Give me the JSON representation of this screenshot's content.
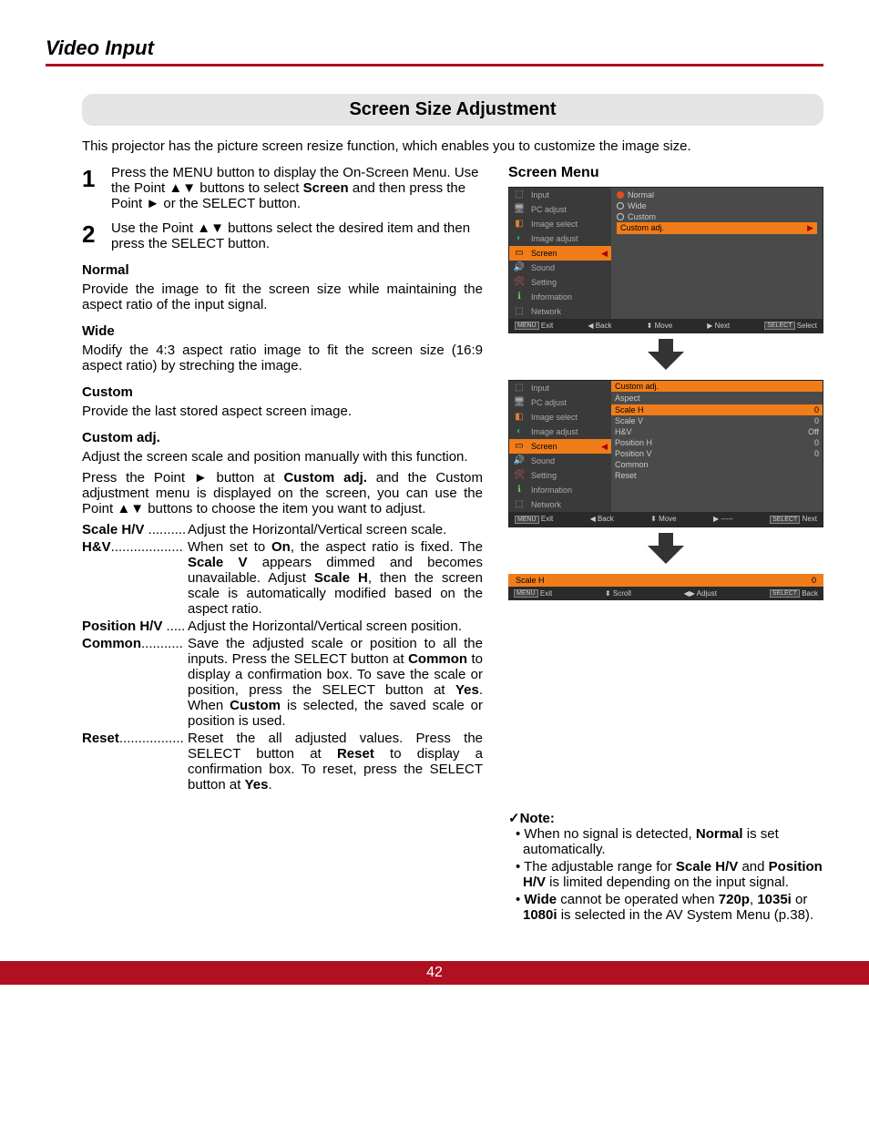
{
  "header": {
    "title": "Video Input"
  },
  "section": {
    "title": "Screen Size Adjustment"
  },
  "intro": "This projector has the picture screen resize function, which enables you to customize the image size.",
  "steps": {
    "s1_num": "1",
    "s1": "Press the MENU button to display the On-Screen Menu. Use the Point ▲▼ buttons to select Screen and then press the Point ► or the SELECT button.",
    "s2_num": "2",
    "s2": "Use the Point ▲▼ buttons select the desired item and then press the SELECT button."
  },
  "normal": {
    "h": "Normal",
    "p": "Provide the image to fit the screen size while maintaining the aspect ratio of the input signal."
  },
  "wide": {
    "h": "Wide",
    "p": "Modify the 4:3 aspect ratio image to fit the screen size (16:9 aspect ratio) by streching the image."
  },
  "custom": {
    "h": "Custom",
    "p": "Provide the last stored aspect screen image."
  },
  "customadj": {
    "h": "Custom adj.",
    "p1": "Adjust the screen scale and position manually with this function.",
    "p2": "Press the Point ► button at Custom adj. and the Custom adjustment menu is displayed on the screen, you can use the Point ▲▼ buttons to choose the item you want to adjust."
  },
  "defs": {
    "scalehv_t": "Scale H/V",
    "scalehv_d": "Adjust the Horizontal/Vertical screen scale.",
    "hv_t": "H&V",
    "hv_d": "When set to On, the aspect ratio is fixed. The Scale V appears dimmed and becomes unavailable. Adjust Scale H, then the screen scale is automatically modified based on the aspect ratio.",
    "poshv_t": "Position H/V",
    "poshv_d": "Adjust the Horizontal/Vertical screen position.",
    "common_t": "Common",
    "common_d": "Save the adjusted scale or position to all the inputs. Press the SELECT button at Common to display a confirmation box. To save the scale or position, press the SELECT button at Yes. When Custom is selected, the saved scale or position is used.",
    "reset_t": "Reset",
    "reset_d": "Reset the all adjusted values. Press the SELECT button at Reset to display a confirmation box. To reset, press the SELECT button at Yes."
  },
  "rcol": {
    "title": "Screen Menu"
  },
  "osd_side": {
    "input": "Input",
    "pc": "PC adjust",
    "imgsel": "Image select",
    "imgadj": "Image adjust",
    "screen": "Screen",
    "sound": "Sound",
    "setting": "Setting",
    "info": "Information",
    "net": "Network"
  },
  "osd1_opts": {
    "normal": "Normal",
    "wide": "Wide",
    "custom": "Custom",
    "customadj": "Custom adj."
  },
  "osd1_foot": {
    "exit": "Exit",
    "back": "◀ Back",
    "move": "Move",
    "next": "▶ Next",
    "select": "Select"
  },
  "osd2_opts": {
    "head": "Custom adj.",
    "aspect": "Aspect",
    "scaleh": "Scale H",
    "scaleh_v": "0",
    "scalev": "Scale V",
    "scalev_v": "0",
    "hv": "H&V",
    "hv_v": "Off",
    "posh": "Position H",
    "posh_v": "0",
    "posv": "Position V",
    "posv_v": "0",
    "common": "Common",
    "reset": "Reset"
  },
  "osd2_foot": {
    "exit": "Exit",
    "back": "◀ Back",
    "move": "Move",
    "dash": "▶ -----",
    "next": "Next"
  },
  "bar": {
    "label": "Scale H",
    "value": "0"
  },
  "bar_foot": {
    "exit": "Exit",
    "scroll": "Scroll",
    "adjust": "◀▶ Adjust",
    "back": "Back"
  },
  "note": {
    "title": "✓Note:",
    "n1": "• When no signal is detected, Normal is set automatically.",
    "n2": "• The adjustable range for Scale H/V and Position H/V is limited depending on the input signal.",
    "n3": "• Wide cannot be operated when 720p, 1035i or 1080i is selected in the AV System Menu (p.38)."
  },
  "footer": {
    "page": "42"
  },
  "keys": {
    "menu": "MENU",
    "select": "SELECT",
    "updown": "⬍"
  }
}
